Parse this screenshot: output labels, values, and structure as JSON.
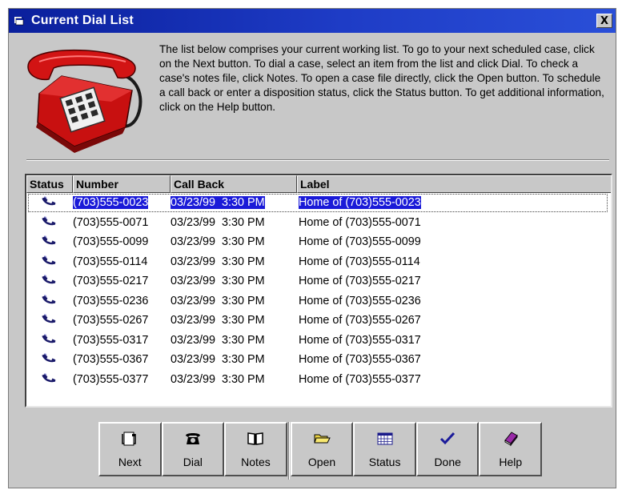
{
  "window": {
    "title": "Current Dial List",
    "close_glyph": "X"
  },
  "description": "The list below comprises your current working list. To go to your next scheduled case, click on the Next button. To dial a case, select an item from the list and click Dial. To check a case's notes file, click Notes. To open a case file directly, click the Open button. To schedule a call back or enter a disposition status, click the Status button. To get additional information, click on the Help button.",
  "list": {
    "columns": [
      "Status",
      "Number",
      "Call Back",
      "Label"
    ],
    "selected_index": 0,
    "rows": [
      {
        "status_icon": "handset-icon",
        "number": "(703)555-0023",
        "callback": "03/23/99  3:30 PM",
        "label": "Home of (703)555-0023"
      },
      {
        "status_icon": "handset-icon",
        "number": "(703)555-0071",
        "callback": "03/23/99  3:30 PM",
        "label": "Home of (703)555-0071"
      },
      {
        "status_icon": "handset-icon",
        "number": "(703)555-0099",
        "callback": "03/23/99  3:30 PM",
        "label": "Home of (703)555-0099"
      },
      {
        "status_icon": "handset-icon",
        "number": "(703)555-0114",
        "callback": "03/23/99  3:30 PM",
        "label": "Home of (703)555-0114"
      },
      {
        "status_icon": "handset-icon",
        "number": "(703)555-0217",
        "callback": "03/23/99  3:30 PM",
        "label": "Home of (703)555-0217"
      },
      {
        "status_icon": "handset-icon",
        "number": "(703)555-0236",
        "callback": "03/23/99  3:30 PM",
        "label": "Home of (703)555-0236"
      },
      {
        "status_icon": "handset-icon",
        "number": "(703)555-0267",
        "callback": "03/23/99  3:30 PM",
        "label": "Home of (703)555-0267"
      },
      {
        "status_icon": "handset-icon",
        "number": "(703)555-0317",
        "callback": "03/23/99  3:30 PM",
        "label": "Home of (703)555-0317"
      },
      {
        "status_icon": "handset-icon",
        "number": "(703)555-0367",
        "callback": "03/23/99  3:30 PM",
        "label": "Home of (703)555-0367"
      },
      {
        "status_icon": "handset-icon",
        "number": "(703)555-0377",
        "callback": "03/23/99  3:30 PM",
        "label": "Home of (703)555-0377"
      }
    ]
  },
  "toolbar": {
    "buttons": [
      {
        "id": "next",
        "label": "Next",
        "icon": "next-page-icon"
      },
      {
        "id": "dial",
        "label": "Dial",
        "icon": "telephone-icon"
      },
      {
        "id": "notes",
        "label": "Notes",
        "icon": "open-book-icon"
      },
      {
        "id": "open",
        "label": "Open",
        "icon": "folder-open-icon"
      },
      {
        "id": "status",
        "label": "Status",
        "icon": "calendar-grid-icon"
      },
      {
        "id": "done",
        "label": "Done",
        "icon": "checkmark-icon"
      },
      {
        "id": "help",
        "label": "Help",
        "icon": "help-book-icon"
      }
    ]
  },
  "colors": {
    "title_bar": "#0a1f9c",
    "selection": "#1a1ad8",
    "face": "#c8c8c8",
    "phone_red": "#d21414"
  }
}
